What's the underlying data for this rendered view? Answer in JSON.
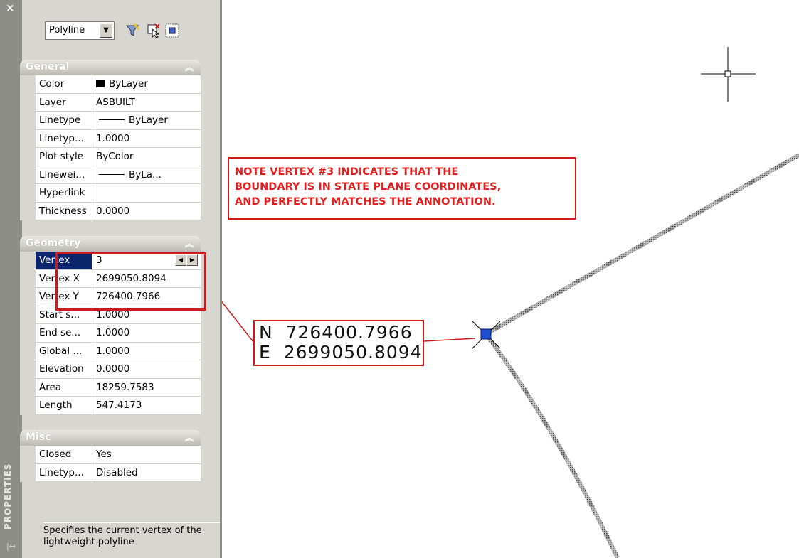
{
  "palette": {
    "title": "PROPERTIES",
    "object_type": "Polyline",
    "sections": {
      "general": {
        "title": "General",
        "rows": [
          {
            "label": "Color",
            "value": "ByLayer"
          },
          {
            "label": "Layer",
            "value": "ASBUILT"
          },
          {
            "label": "Linetype",
            "value": "ByLayer"
          },
          {
            "label": "Linetyp...",
            "value": "1.0000"
          },
          {
            "label": "Plot style",
            "value": "ByColor"
          },
          {
            "label": "Linewei...",
            "value": "ByLa..."
          },
          {
            "label": "Hyperlink",
            "value": ""
          },
          {
            "label": "Thickness",
            "value": "0.0000"
          }
        ]
      },
      "geometry": {
        "title": "Geometry",
        "rows": [
          {
            "label": "Vertex",
            "value": "3"
          },
          {
            "label": "Vertex X",
            "value": "2699050.8094"
          },
          {
            "label": "Vertex Y",
            "value": "726400.7966"
          },
          {
            "label": "Start s...",
            "value": "1.0000"
          },
          {
            "label": "End se...",
            "value": "1.0000"
          },
          {
            "label": "Global ...",
            "value": "1.0000"
          },
          {
            "label": "Elevation",
            "value": "0.0000"
          },
          {
            "label": "Area",
            "value": "18259.7583"
          },
          {
            "label": "Length",
            "value": "547.4173"
          }
        ]
      },
      "misc": {
        "title": "Misc",
        "rows": [
          {
            "label": "Closed",
            "value": "Yes"
          },
          {
            "label": "Linetyp...",
            "value": "Disabled"
          }
        ]
      }
    },
    "description": "Specifies the current vertex of the lightweight polyline"
  },
  "drawing": {
    "note_lines": [
      "NOTE VERTEX #3 INDICATES THAT THE",
      "BOUNDARY IS IN STATE PLANE COORDINATES,",
      "AND PERFECTLY MATCHES THE ANNOTATION."
    ],
    "northing_label": "N  726400.7966",
    "easting_label": "E  2699050.8094"
  },
  "colors": {
    "callout_red": "#cc1b1b",
    "note_text_red": "#e41e1e",
    "selected_row_blue": "#0b246b",
    "grip_blue": "#1f4fd1"
  }
}
